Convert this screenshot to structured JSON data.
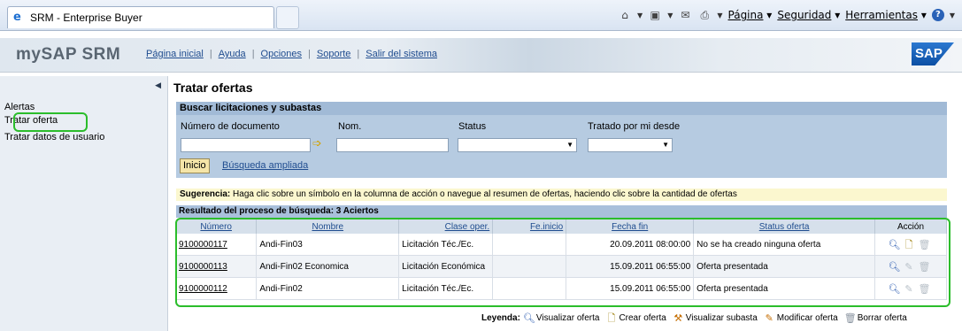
{
  "browser": {
    "tab_title": "SRM - Enterprise Buyer",
    "menus": [
      "Página",
      "Seguridad",
      "Herramientas"
    ]
  },
  "header": {
    "brand": "mySAP SRM",
    "links": [
      "Página inicial",
      "Ayuda",
      "Opciones",
      "Soporte",
      "Salir del sistema"
    ],
    "logo": "SAP"
  },
  "sidebar": {
    "items": [
      {
        "label": "Alertas"
      },
      {
        "label": "Tratar oferta"
      },
      {
        "label": "Tratar datos de usuario"
      }
    ]
  },
  "page": {
    "title": "Tratar ofertas"
  },
  "search": {
    "heading": "Buscar licitaciones y subastas",
    "doc_number_label": "Número de documento",
    "name_label": "Nom.",
    "status_label": "Status",
    "processed_label": "Tratado por mi desde",
    "start_button": "Inicio",
    "advanced_link": "Búsqueda ampliada"
  },
  "hint": {
    "prefix": "Sugerencia:",
    "text": "Haga clic sobre un símbolo en la columna de acción o navegue al resumen de ofertas, haciendo clic sobre la cantidad de ofertas"
  },
  "results": {
    "heading": "Resultado del proceso de búsqueda:  3 Aciertos",
    "columns": [
      "Número",
      "Nombre",
      "Clase oper.",
      "Fe.inicio",
      "Fecha fin",
      "Status oferta",
      "Acción"
    ],
    "rows": [
      {
        "number": "9100000117",
        "name": "Andi-Fin03",
        "type": "Licitación Téc./Ec.",
        "start": "",
        "end": "20.09.2011 08:00:00",
        "status": "No se ha creado ninguna oferta",
        "actions": [
          "view",
          "create",
          "delete-disabled"
        ]
      },
      {
        "number": "9100000113",
        "name": "Andi-Fin02 Economica",
        "type": "Licitación Económica",
        "start": "",
        "end": "15.09.2011 06:55:00",
        "status": "Oferta presentada",
        "actions": [
          "view",
          "edit-disabled",
          "delete-disabled"
        ]
      },
      {
        "number": "9100000112",
        "name": "Andi-Fin02",
        "type": "Licitación Téc./Ec.",
        "start": "",
        "end": "15.09.2011 06:55:00",
        "status": "Oferta presentada",
        "actions": [
          "view",
          "edit-disabled",
          "delete-disabled"
        ]
      }
    ]
  },
  "legend": {
    "title": "Leyenda:",
    "items": [
      "Visualizar oferta",
      "Crear oferta",
      "Visualizar subasta",
      "Modificar oferta",
      "Borrar oferta"
    ]
  },
  "colors": {
    "highlight": "#2bbd2b",
    "panel": "#b6cbe1",
    "link": "#1f4c8f"
  }
}
